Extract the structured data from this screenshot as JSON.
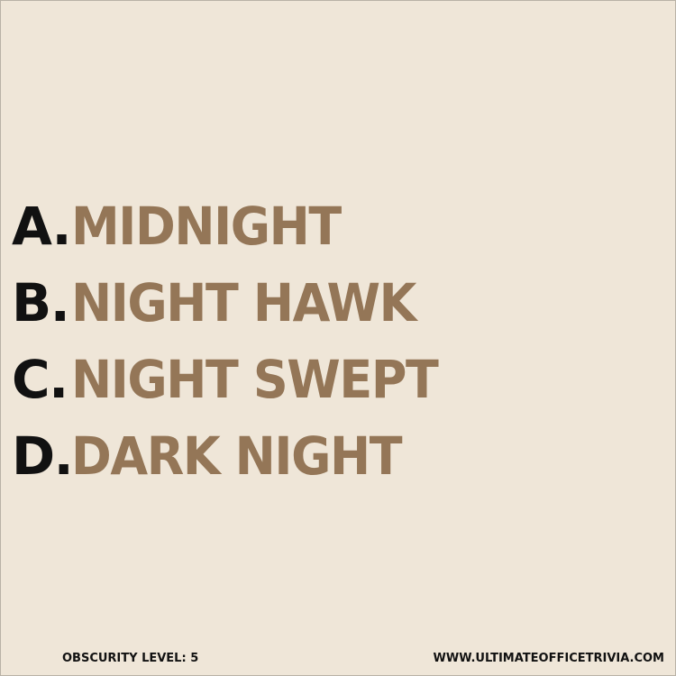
{
  "colors": {
    "background": "#efe6d8",
    "letter": "#111111",
    "answer": "#947657"
  },
  "options": [
    {
      "letter": "A.",
      "text": "MIDNIGHT"
    },
    {
      "letter": "B.",
      "text": "NIGHT HAWK"
    },
    {
      "letter": "C.",
      "text": "NIGHT SWEPT"
    },
    {
      "letter": "D.",
      "text": "DARK NIGHT"
    }
  ],
  "footer": {
    "obscurity": "OBSCURITY LEVEL: 5",
    "website": "WWW.ULTIMATEOFFICETRIVIA.COM"
  }
}
